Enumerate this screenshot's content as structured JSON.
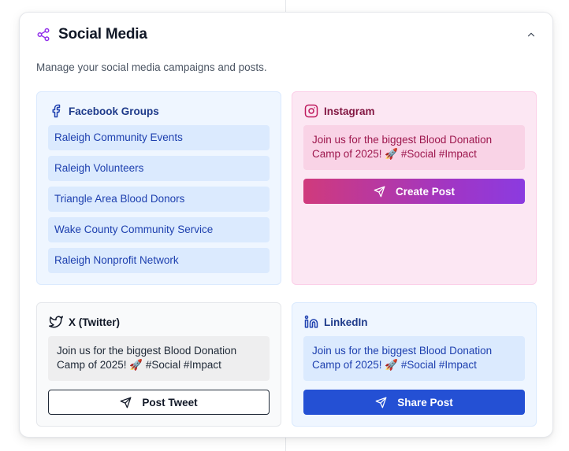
{
  "card": {
    "title": "Social Media",
    "description": "Manage your social media campaigns and posts.",
    "icon": "share-icon",
    "collapse_icon": "chevron-up-icon"
  },
  "facebook": {
    "title": "Facebook Groups",
    "icon": "facebook-icon",
    "groups": [
      "Raleigh Community Events",
      "Raleigh Volunteers",
      "Triangle Area Blood Donors",
      "Wake County Community Service",
      "Raleigh Nonprofit Network"
    ]
  },
  "instagram": {
    "title": "Instagram",
    "icon": "instagram-icon",
    "message": "Join us for the biggest Blood Donation Camp of 2025! 🚀 #Social #Impact",
    "button_label": "Create Post"
  },
  "twitter": {
    "title": "X (Twitter)",
    "icon": "twitter-bird-icon",
    "message": "Join us for the biggest Blood Donation Camp of 2025! 🚀 #Social #Impact",
    "button_label": "Post Tweet"
  },
  "linkedin": {
    "title": "LinkedIn",
    "icon": "linkedin-icon",
    "message": "Join us for the biggest Blood Donation Camp of 2025! 🚀 #Social #Impact",
    "button_label": "Share Post"
  },
  "colors": {
    "accent_purple": "#9333ea",
    "facebook_blue": "#1e40af",
    "instagram_pink": "#be185d",
    "linkedin_blue": "#2450d4"
  }
}
